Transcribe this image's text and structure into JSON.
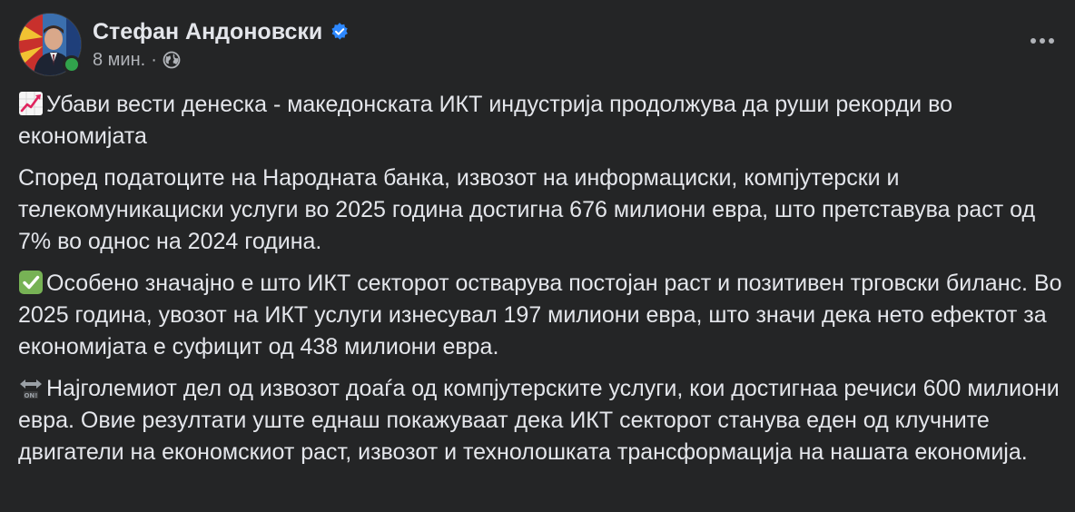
{
  "post": {
    "author": "Стефан Андоновски",
    "time": "8 мин.",
    "separator": "·",
    "verified_icon": "verified-badge-icon",
    "audience_icon": "globe-icon",
    "more_icon": "more-options-icon",
    "colors": {
      "background": "#242526",
      "text": "#e4e6eb",
      "secondary_text": "#b0b3b8",
      "verified": "#2d88ff",
      "online": "#31a24c"
    },
    "paragraphs": [
      {
        "emoji": "chart-increasing-icon",
        "text": "Убави вести денеска - македонската ИКТ индустрија продолжува да руши рекорди во економијата"
      },
      {
        "emoji": "",
        "text": "Според податоците на Народната банка, извозот на информациски, компјутерски и телекомуникациски услуги во 2025 година достигна 676 милиони евра, што претставува раст од 7% во однос на 2024 година."
      },
      {
        "emoji": "check-mark-button-icon",
        "text": "Особено значајно е што ИКТ секторот остварува постојан раст и позитивен трговски биланс. Во 2025 година, увозот на ИКТ услуги изнесувал 197 милиони евра, што значи дека нето ефектот за економијата е суфицит од 438 милиони евра."
      },
      {
        "emoji": "on-arrow-icon",
        "text": "Најголемиот дел од извозот доаѓа од компјутерските услуги, кои достигнаа речиси 600 милиони евра. Овие резултати уште еднаш покажуваат дека ИКТ секторот станува еден од клучните двигатели на економскиот раст, извозот и технолошката трансформација на нашата економија."
      }
    ]
  }
}
